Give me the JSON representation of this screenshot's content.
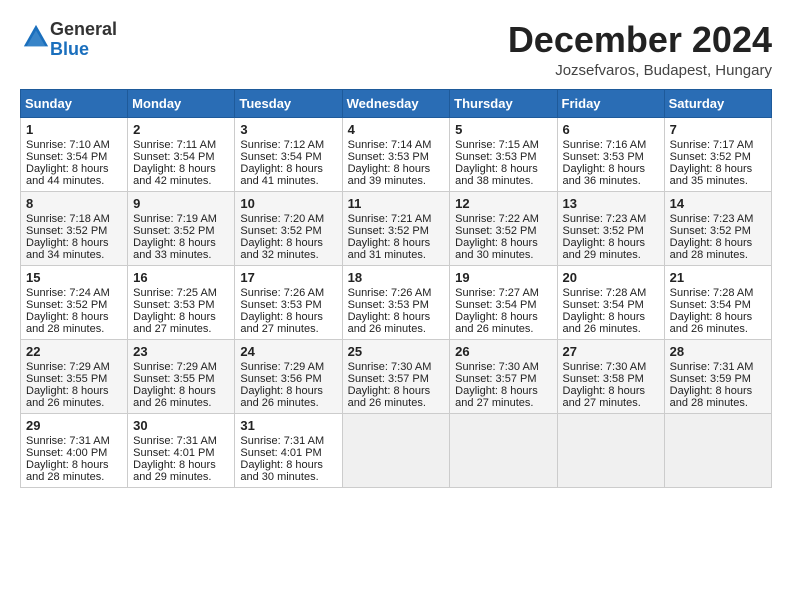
{
  "header": {
    "logo_general": "General",
    "logo_blue": "Blue",
    "month_title": "December 2024",
    "location": "Jozsefvaros, Budapest, Hungary"
  },
  "weekdays": [
    "Sunday",
    "Monday",
    "Tuesday",
    "Wednesday",
    "Thursday",
    "Friday",
    "Saturday"
  ],
  "weeks": [
    [
      {
        "day": "1",
        "sunrise": "Sunrise: 7:10 AM",
        "sunset": "Sunset: 3:54 PM",
        "daylight": "Daylight: 8 hours and 44 minutes."
      },
      {
        "day": "2",
        "sunrise": "Sunrise: 7:11 AM",
        "sunset": "Sunset: 3:54 PM",
        "daylight": "Daylight: 8 hours and 42 minutes."
      },
      {
        "day": "3",
        "sunrise": "Sunrise: 7:12 AM",
        "sunset": "Sunset: 3:54 PM",
        "daylight": "Daylight: 8 hours and 41 minutes."
      },
      {
        "day": "4",
        "sunrise": "Sunrise: 7:14 AM",
        "sunset": "Sunset: 3:53 PM",
        "daylight": "Daylight: 8 hours and 39 minutes."
      },
      {
        "day": "5",
        "sunrise": "Sunrise: 7:15 AM",
        "sunset": "Sunset: 3:53 PM",
        "daylight": "Daylight: 8 hours and 38 minutes."
      },
      {
        "day": "6",
        "sunrise": "Sunrise: 7:16 AM",
        "sunset": "Sunset: 3:53 PM",
        "daylight": "Daylight: 8 hours and 36 minutes."
      },
      {
        "day": "7",
        "sunrise": "Sunrise: 7:17 AM",
        "sunset": "Sunset: 3:52 PM",
        "daylight": "Daylight: 8 hours and 35 minutes."
      }
    ],
    [
      {
        "day": "8",
        "sunrise": "Sunrise: 7:18 AM",
        "sunset": "Sunset: 3:52 PM",
        "daylight": "Daylight: 8 hours and 34 minutes."
      },
      {
        "day": "9",
        "sunrise": "Sunrise: 7:19 AM",
        "sunset": "Sunset: 3:52 PM",
        "daylight": "Daylight: 8 hours and 33 minutes."
      },
      {
        "day": "10",
        "sunrise": "Sunrise: 7:20 AM",
        "sunset": "Sunset: 3:52 PM",
        "daylight": "Daylight: 8 hours and 32 minutes."
      },
      {
        "day": "11",
        "sunrise": "Sunrise: 7:21 AM",
        "sunset": "Sunset: 3:52 PM",
        "daylight": "Daylight: 8 hours and 31 minutes."
      },
      {
        "day": "12",
        "sunrise": "Sunrise: 7:22 AM",
        "sunset": "Sunset: 3:52 PM",
        "daylight": "Daylight: 8 hours and 30 minutes."
      },
      {
        "day": "13",
        "sunrise": "Sunrise: 7:23 AM",
        "sunset": "Sunset: 3:52 PM",
        "daylight": "Daylight: 8 hours and 29 minutes."
      },
      {
        "day": "14",
        "sunrise": "Sunrise: 7:23 AM",
        "sunset": "Sunset: 3:52 PM",
        "daylight": "Daylight: 8 hours and 28 minutes."
      }
    ],
    [
      {
        "day": "15",
        "sunrise": "Sunrise: 7:24 AM",
        "sunset": "Sunset: 3:52 PM",
        "daylight": "Daylight: 8 hours and 28 minutes."
      },
      {
        "day": "16",
        "sunrise": "Sunrise: 7:25 AM",
        "sunset": "Sunset: 3:53 PM",
        "daylight": "Daylight: 8 hours and 27 minutes."
      },
      {
        "day": "17",
        "sunrise": "Sunrise: 7:26 AM",
        "sunset": "Sunset: 3:53 PM",
        "daylight": "Daylight: 8 hours and 27 minutes."
      },
      {
        "day": "18",
        "sunrise": "Sunrise: 7:26 AM",
        "sunset": "Sunset: 3:53 PM",
        "daylight": "Daylight: 8 hours and 26 minutes."
      },
      {
        "day": "19",
        "sunrise": "Sunrise: 7:27 AM",
        "sunset": "Sunset: 3:54 PM",
        "daylight": "Daylight: 8 hours and 26 minutes."
      },
      {
        "day": "20",
        "sunrise": "Sunrise: 7:28 AM",
        "sunset": "Sunset: 3:54 PM",
        "daylight": "Daylight: 8 hours and 26 minutes."
      },
      {
        "day": "21",
        "sunrise": "Sunrise: 7:28 AM",
        "sunset": "Sunset: 3:54 PM",
        "daylight": "Daylight: 8 hours and 26 minutes."
      }
    ],
    [
      {
        "day": "22",
        "sunrise": "Sunrise: 7:29 AM",
        "sunset": "Sunset: 3:55 PM",
        "daylight": "Daylight: 8 hours and 26 minutes."
      },
      {
        "day": "23",
        "sunrise": "Sunrise: 7:29 AM",
        "sunset": "Sunset: 3:55 PM",
        "daylight": "Daylight: 8 hours and 26 minutes."
      },
      {
        "day": "24",
        "sunrise": "Sunrise: 7:29 AM",
        "sunset": "Sunset: 3:56 PM",
        "daylight": "Daylight: 8 hours and 26 minutes."
      },
      {
        "day": "25",
        "sunrise": "Sunrise: 7:30 AM",
        "sunset": "Sunset: 3:57 PM",
        "daylight": "Daylight: 8 hours and 26 minutes."
      },
      {
        "day": "26",
        "sunrise": "Sunrise: 7:30 AM",
        "sunset": "Sunset: 3:57 PM",
        "daylight": "Daylight: 8 hours and 27 minutes."
      },
      {
        "day": "27",
        "sunrise": "Sunrise: 7:30 AM",
        "sunset": "Sunset: 3:58 PM",
        "daylight": "Daylight: 8 hours and 27 minutes."
      },
      {
        "day": "28",
        "sunrise": "Sunrise: 7:31 AM",
        "sunset": "Sunset: 3:59 PM",
        "daylight": "Daylight: 8 hours and 28 minutes."
      }
    ],
    [
      {
        "day": "29",
        "sunrise": "Sunrise: 7:31 AM",
        "sunset": "Sunset: 4:00 PM",
        "daylight": "Daylight: 8 hours and 28 minutes."
      },
      {
        "day": "30",
        "sunrise": "Sunrise: 7:31 AM",
        "sunset": "Sunset: 4:01 PM",
        "daylight": "Daylight: 8 hours and 29 minutes."
      },
      {
        "day": "31",
        "sunrise": "Sunrise: 7:31 AM",
        "sunset": "Sunset: 4:01 PM",
        "daylight": "Daylight: 8 hours and 30 minutes."
      },
      null,
      null,
      null,
      null
    ]
  ]
}
